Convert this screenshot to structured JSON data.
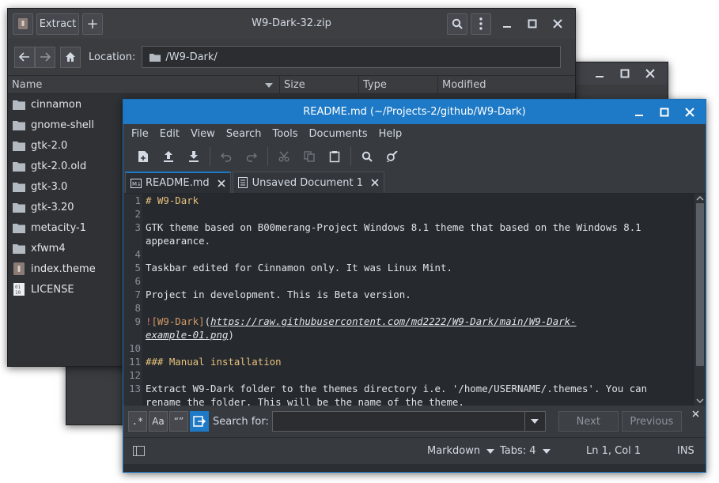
{
  "archive": {
    "title": "W9-Dark-32.zip",
    "extract_label": "Extract",
    "add_label": "+",
    "location_label": "Location:",
    "location_value": "/W9-Dark/",
    "columns": [
      "Name",
      "Size",
      "Type",
      "Modified"
    ],
    "files": [
      {
        "name": "cinnamon",
        "icon": "folder-icon"
      },
      {
        "name": "gnome-shell",
        "icon": "folder-icon"
      },
      {
        "name": "gtk-2.0",
        "icon": "folder-icon"
      },
      {
        "name": "gtk-2.0.old",
        "icon": "folder-icon"
      },
      {
        "name": "gtk-3.0",
        "icon": "folder-icon"
      },
      {
        "name": "gtk-3.20",
        "icon": "folder-icon"
      },
      {
        "name": "metacity-1",
        "icon": "folder-icon"
      },
      {
        "name": "xfwm4",
        "icon": "folder-icon"
      },
      {
        "name": "index.theme",
        "icon": "archive-file-icon"
      },
      {
        "name": "LICENSE",
        "icon": "binary-file-icon"
      }
    ]
  },
  "editor": {
    "title": "README.md (~/Projects-2/github/W9-Dark)",
    "menu": [
      "File",
      "Edit",
      "View",
      "Search",
      "Tools",
      "Documents",
      "Help"
    ],
    "tabs": [
      {
        "label": "README.md",
        "active": true
      },
      {
        "label": "Unsaved Document 1",
        "active": false
      }
    ],
    "lines": [
      {
        "n": "1",
        "text": "# W9-Dark"
      },
      {
        "n": "2",
        "text": ""
      },
      {
        "n": "3",
        "text": "GTK theme based on B00merang-Project Windows 8.1 theme that based on the Windows 8.1"
      },
      {
        "n": "",
        "text": "appearance."
      },
      {
        "n": "4",
        "text": ""
      },
      {
        "n": "5",
        "text": "Taskbar edited for Cinnamon only. It was Linux Mint."
      },
      {
        "n": "6",
        "text": ""
      },
      {
        "n": "7",
        "text": "Project in development. This is Beta version."
      },
      {
        "n": "8",
        "text": ""
      },
      {
        "n": "9",
        "text": ""
      },
      {
        "n": "",
        "text": ""
      },
      {
        "n": "10",
        "text": ""
      },
      {
        "n": "11",
        "text": "### Manual installation"
      },
      {
        "n": "12",
        "text": ""
      },
      {
        "n": "13",
        "text": "Extract W9-Dark folder to the themes directory i.e. '/home/USERNAME/.themes'. You can"
      },
      {
        "n": "",
        "text": "rename the folder. This will be the name of the theme."
      }
    ],
    "link_line": {
      "bang": "!",
      "label": "[W9-Dark]",
      "paren_open": "(",
      "url_1": "https://raw.githubusercontent.com/md2222/W9-Dark/main/W9-Dark-",
      "url_2": "example-01.png",
      "paren_close": ")"
    },
    "search": {
      "regex_label": ".*",
      "case_label": "Aa",
      "word_label": "“”",
      "label": "Search for:",
      "value": "",
      "next_label": "Next",
      "previous_label": "Previous"
    },
    "status": {
      "language": "Markdown",
      "tabs": "Tabs: 4",
      "position": "Ln 1, Col 1",
      "mode": "INS"
    }
  }
}
